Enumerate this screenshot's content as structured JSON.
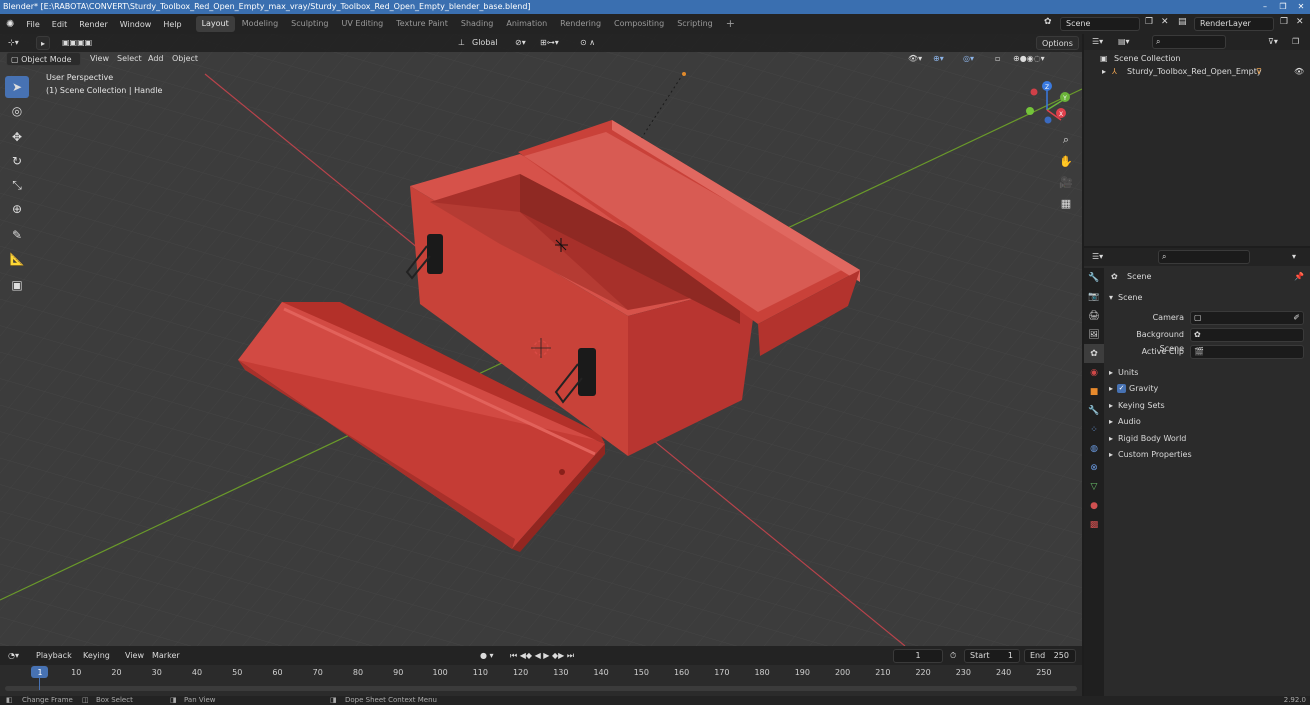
{
  "window": {
    "title": "Blender* [E:\\RABOTA\\CONVERT\\Sturdy_Toolbox_Red_Open_Empty_max_vray/Sturdy_Toolbox_Red_Open_Empty_blender_base.blend]"
  },
  "menu": {
    "items": [
      "File",
      "Edit",
      "Render",
      "Window",
      "Help"
    ]
  },
  "workspaces": [
    {
      "label": "Layout",
      "active": true
    },
    {
      "label": "Modeling",
      "active": false
    },
    {
      "label": "Sculpting",
      "active": false
    },
    {
      "label": "UV Editing",
      "active": false
    },
    {
      "label": "Texture Paint",
      "active": false
    },
    {
      "label": "Shading",
      "active": false
    },
    {
      "label": "Animation",
      "active": false
    },
    {
      "label": "Rendering",
      "active": false
    },
    {
      "label": "Compositing",
      "active": false
    },
    {
      "label": "Scripting",
      "active": false
    }
  ],
  "top_right": {
    "scene": "Scene",
    "render_layer": "RenderLayer"
  },
  "viewport_header": {
    "mode": "Object Mode",
    "menus": [
      "View",
      "Select",
      "Add",
      "Object"
    ],
    "orientation": "Global",
    "options": "Options"
  },
  "viewport": {
    "perspective": "User Perspective",
    "collection_info": "(1) Scene Collection | Handle",
    "gizmo_axes": [
      "X",
      "Y",
      "Z"
    ]
  },
  "outliner": {
    "root": "Scene Collection",
    "object": "Sturdy_Toolbox_Red_Open_Empty"
  },
  "properties": {
    "context": "Scene",
    "panel": "Scene",
    "fields": [
      {
        "label": "Camera"
      },
      {
        "label": "Background Scene"
      },
      {
        "label": "Active Clip"
      }
    ],
    "sections": [
      "Units",
      "Gravity",
      "Keying Sets",
      "Audio",
      "Rigid Body World",
      "Custom Properties"
    ],
    "gravity_checked": true
  },
  "timeline": {
    "menus": [
      "Playback",
      "Keying",
      "View",
      "Marker"
    ],
    "current_frame": "1",
    "start_label": "Start",
    "start": "1",
    "end_label": "End",
    "end": "250",
    "ruler": [
      "1",
      "10",
      "20",
      "30",
      "40",
      "50",
      "60",
      "70",
      "80",
      "90",
      "100",
      "110",
      "120",
      "130",
      "140",
      "150",
      "160",
      "170",
      "180",
      "190",
      "200",
      "210",
      "220",
      "230",
      "240",
      "250"
    ]
  },
  "statusbar": {
    "items": [
      "Change Frame",
      "Box Select",
      "Pan View",
      "Dope Sheet Context Menu"
    ],
    "version": "2.92.0"
  },
  "colors": {
    "accent": "#4772b3",
    "toolbox_red": "#c8423c",
    "x_axis": "#b8434b",
    "y_axis": "#6a9a2a"
  }
}
